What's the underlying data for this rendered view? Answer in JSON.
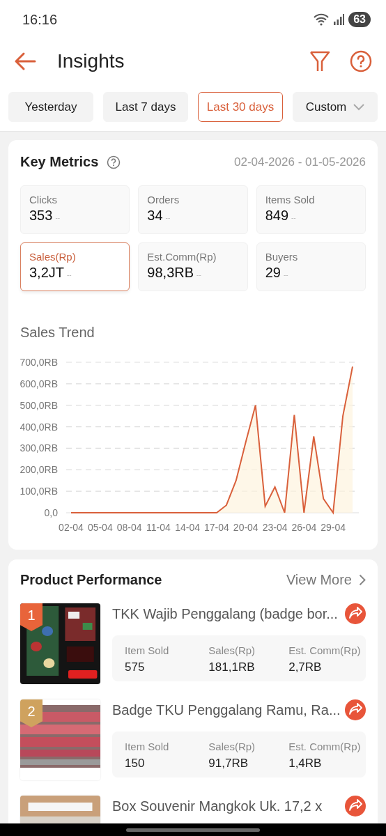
{
  "status_bar": {
    "time": "16:16",
    "battery": "63"
  },
  "header": {
    "title": "Insights"
  },
  "ranges": [
    {
      "label": "Yesterday",
      "selected": false,
      "kind": "chip"
    },
    {
      "label": "Last 7 days",
      "selected": false,
      "kind": "chip"
    },
    {
      "label": "Last 30 days",
      "selected": true,
      "kind": "chip"
    },
    {
      "label": "Custom",
      "selected": false,
      "kind": "dropdown"
    }
  ],
  "key_metrics": {
    "title": "Key Metrics",
    "date_range": "02-04-2026 - 01-05-2026",
    "metrics": [
      {
        "label": "Clicks",
        "value": "353",
        "change": "--",
        "selected": false
      },
      {
        "label": "Orders",
        "value": "34",
        "change": "--",
        "selected": false
      },
      {
        "label": "Items Sold",
        "value": "849",
        "change": "--",
        "selected": false
      },
      {
        "label": "Sales(Rp)",
        "value": "3,2JT",
        "change": "--",
        "selected": true
      },
      {
        "label": "Est.Comm(Rp)",
        "value": "98,3RB",
        "change": "--",
        "selected": false
      },
      {
        "label": "Buyers",
        "value": "29",
        "change": "--",
        "selected": false
      }
    ]
  },
  "sales_trend": {
    "title": "Sales Trend",
    "chart_data": {
      "type": "area",
      "categories": [
        "02-04",
        null,
        null,
        "05-04",
        null,
        null,
        "08-04",
        null,
        null,
        "11-04",
        null,
        null,
        "14-04",
        null,
        null,
        "17-04",
        null,
        null,
        "20-04",
        null,
        null,
        "23-04",
        null,
        null,
        "26-04",
        null,
        null,
        "29-04",
        null,
        null
      ],
      "ylim": [
        0,
        700
      ],
      "yticks": [
        {
          "value": 0,
          "label": "0,0"
        },
        {
          "value": 100,
          "label": "100,0RB"
        },
        {
          "value": 200,
          "label": "200,0RB"
        },
        {
          "value": 300,
          "label": "300,0RB"
        },
        {
          "value": 400,
          "label": "400,0RB"
        },
        {
          "value": 500,
          "label": "500,0RB"
        },
        {
          "value": 600,
          "label": "600,0RB"
        },
        {
          "value": 700,
          "label": "700,0RB"
        }
      ],
      "grid": true,
      "series": [
        {
          "color": "#d9603b",
          "values": [
            0,
            0,
            0,
            0,
            0,
            0,
            0,
            0,
            0,
            0,
            0,
            0,
            0,
            0,
            0,
            0,
            35,
            150,
            330,
            500,
            30,
            120,
            0,
            455,
            0,
            355,
            65,
            0,
            450,
            680
          ]
        }
      ]
    }
  },
  "product_performance": {
    "title": "Product Performance",
    "view_more": "View More",
    "products": [
      {
        "rank": "1",
        "color": "#e8643a",
        "title": "TKK Wajib Penggalang (badge bor...",
        "stats": [
          {
            "label": "Item Sold",
            "value": "575"
          },
          {
            "label": "Sales(Rp)",
            "value": "181,1RB"
          },
          {
            "label": "Est. Comm(Rp)",
            "value": "2,7RB"
          }
        ]
      },
      {
        "rank": "2",
        "color": "#cfa25e",
        "title": "Badge TKU Penggalang Ramu, Ra...",
        "stats": [
          {
            "label": "Item Sold",
            "value": "150"
          },
          {
            "label": "Sales(Rp)",
            "value": "91,7RB"
          },
          {
            "label": "Est. Comm(Rp)",
            "value": "1,4RB"
          }
        ]
      },
      {
        "title": "Box Souvenir Mangkok Uk. 17,2 x"
      }
    ]
  }
}
